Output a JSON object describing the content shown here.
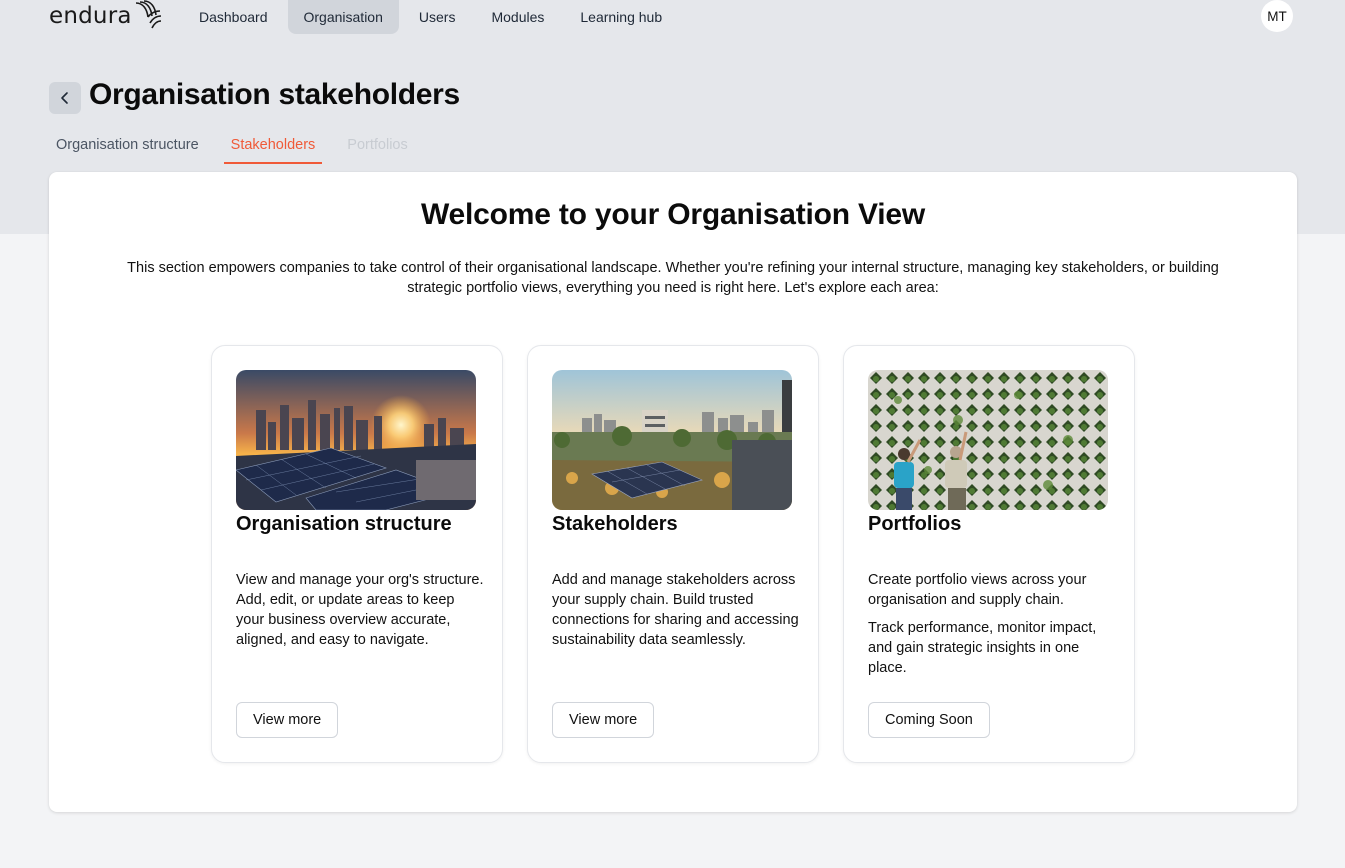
{
  "header": {
    "logo_text": "endura",
    "nav": [
      {
        "label": "Dashboard",
        "active": false
      },
      {
        "label": "Organisation",
        "active": true
      },
      {
        "label": "Users",
        "active": false
      },
      {
        "label": "Modules",
        "active": false
      },
      {
        "label": "Learning hub",
        "active": false
      }
    ],
    "avatar_initials": "MT"
  },
  "page": {
    "back_icon": "chevron-left-icon",
    "title": "Organisation stakeholders",
    "tabs": [
      {
        "label": "Organisation structure",
        "state": "default"
      },
      {
        "label": "Stakeholders",
        "state": "active"
      },
      {
        "label": "Portfolios",
        "state": "disabled"
      }
    ],
    "accent_color": "#f05a38"
  },
  "welcome": {
    "title": "Welcome to your Organisation View",
    "description": "This section empowers companies to take control of their organisational landscape. Whether you're refining your internal structure, managing key stakeholders, or building strategic portfolio views, everything you need is right here. Let's explore each area:"
  },
  "cards": [
    {
      "title": "Organisation structure",
      "image": "solar-panels-city-sunset",
      "paragraphs": [
        "View and manage your org's structure. Add, edit, or update areas to keep your business overview accurate, aligned, and easy to navigate."
      ],
      "button": "View more"
    },
    {
      "title": "Stakeholders",
      "image": "green-roof-solar-buildings",
      "paragraphs": [
        "Add and manage stakeholders across your supply chain. Build trusted connections for sharing and accessing sustainability data seamlessly."
      ],
      "button": "View more"
    },
    {
      "title": "Portfolios",
      "image": "people-at-green-wall",
      "paragraphs": [
        "Create portfolio views across your organisation and supply chain.",
        "Track performance, monitor impact, and gain strategic insights in one place."
      ],
      "button": "Coming Soon"
    }
  ]
}
